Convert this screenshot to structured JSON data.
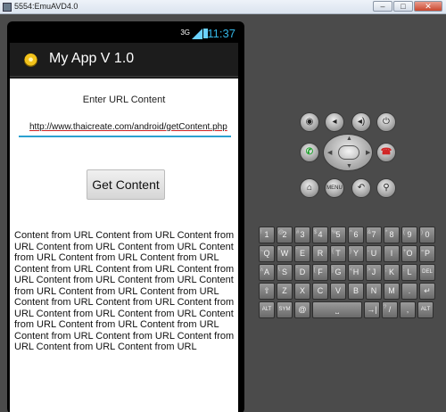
{
  "window": {
    "title": "5554:EmuAVD4.0",
    "controls": [
      "–",
      "□",
      "✕"
    ]
  },
  "status_bar": {
    "signal_label": "3G",
    "time": "11:37"
  },
  "action_bar": {
    "app_title": "My App V 1.0"
  },
  "main": {
    "label": "Enter URL Content",
    "url_value": "http://www.thaicreate.com/android/getContent.php",
    "button_label": "Get Content",
    "result_text": " Content from URL  Content from URL  Content from URL  Content from URL  Content from URL  Content from URL  Content from URL  Content from URL  Content from URL  Content from URL  Content from URL  Content from URL  Content from URL  Content from URL  Content from URL  Content from URL  Content from URL  Content from URL  Content from URL  Content from URL  Content from URL  Content from URL  Content from URL  Content from URL  Content from URL  Content from URL  Content from URL  Content from URL  Content from URL"
  },
  "hardware_buttons": {
    "camera": "camera-icon",
    "volume_down": "volume-down-icon",
    "volume_up": "volume-up-icon",
    "power": "power-icon",
    "call": "call-icon",
    "end_call": "end-call-icon",
    "home": "home-icon",
    "menu": "MENU",
    "back": "back-icon",
    "search": "search-icon"
  },
  "keyboard": {
    "row1": [
      {
        "k": "1",
        "a": "!"
      },
      {
        "k": "2",
        "a": "@"
      },
      {
        "k": "3",
        "a": "#"
      },
      {
        "k": "4",
        "a": "$"
      },
      {
        "k": "5",
        "a": "%"
      },
      {
        "k": "6",
        "a": "^"
      },
      {
        "k": "7",
        "a": "&"
      },
      {
        "k": "8",
        "a": "*"
      },
      {
        "k": "9",
        "a": "("
      },
      {
        "k": "0",
        "a": ")"
      }
    ],
    "row2": [
      {
        "k": "Q",
        "a": "~"
      },
      {
        "k": "W",
        "a": "\""
      },
      {
        "k": "E",
        "a": "´"
      },
      {
        "k": "R",
        "a": ""
      },
      {
        "k": "T",
        "a": "{"
      },
      {
        "k": "Y",
        "a": "}"
      },
      {
        "k": "U",
        "a": "-"
      },
      {
        "k": "I",
        "a": ""
      },
      {
        "k": "O",
        "a": "+"
      },
      {
        "k": "P",
        "a": "="
      }
    ],
    "row3": [
      {
        "k": "A",
        "a": "ʌ"
      },
      {
        "k": "S",
        "a": "\\"
      },
      {
        "k": "D",
        "a": "`"
      },
      {
        "k": "F",
        "a": "["
      },
      {
        "k": "G",
        "a": "]"
      },
      {
        "k": "H",
        "a": "<"
      },
      {
        "k": "J",
        "a": ">"
      },
      {
        "k": "K",
        "a": ";"
      },
      {
        "k": "L",
        "a": ":"
      },
      {
        "k": "DEL",
        "a": ""
      }
    ],
    "row4": [
      {
        "k": "⇧",
        "a": ""
      },
      {
        "k": "Z",
        "a": ""
      },
      {
        "k": "X",
        "a": ""
      },
      {
        "k": "C",
        "a": ""
      },
      {
        "k": "V",
        "a": ""
      },
      {
        "k": "B",
        "a": ""
      },
      {
        "k": "N",
        "a": ""
      },
      {
        "k": "M",
        "a": ""
      },
      {
        "k": ".",
        "a": ""
      },
      {
        "k": "↵",
        "a": ""
      }
    ],
    "row5": [
      {
        "k": "ALT",
        "a": ""
      },
      {
        "k": "SYM",
        "a": ""
      },
      {
        "k": "@",
        "a": ""
      },
      {
        "k": "⎵",
        "a": ""
      },
      {
        "k": "→|",
        "a": ""
      },
      {
        "k": "/",
        "a": "?"
      },
      {
        "k": ",",
        "a": ""
      },
      {
        "k": "ALT",
        "a": ""
      }
    ]
  }
}
